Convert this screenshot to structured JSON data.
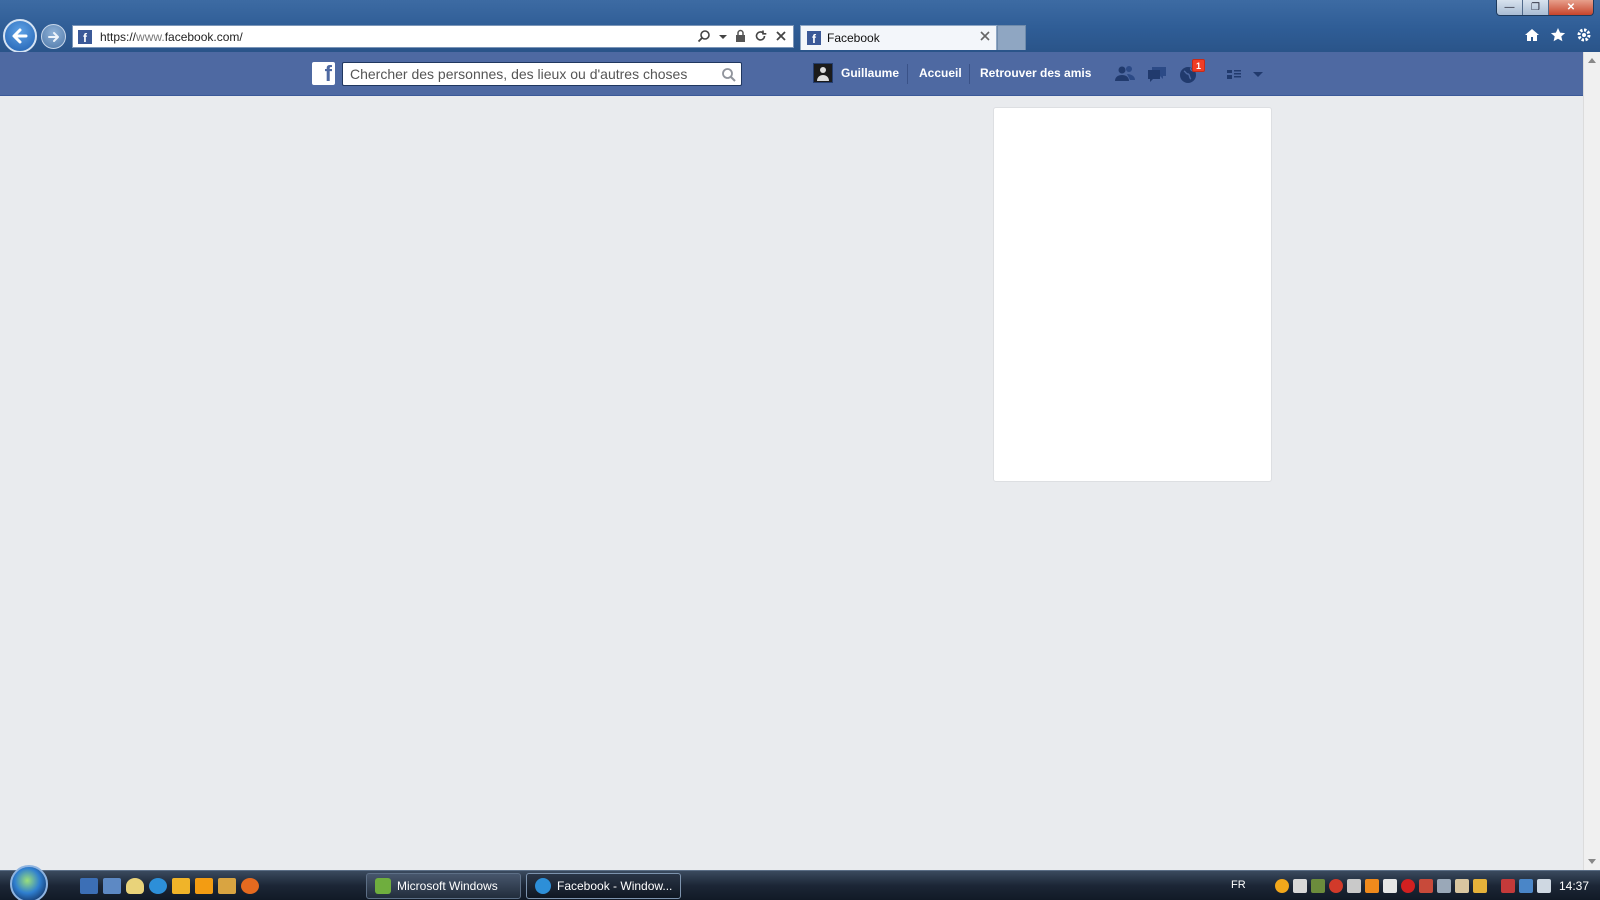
{
  "browser": {
    "url_scheme": "https://",
    "url_host_dim": "www.",
    "url_host": "facebook.com/",
    "tab_title": "Facebook",
    "controls": {
      "minimize": "—",
      "maximize": "❐",
      "close": "✕"
    }
  },
  "facebook": {
    "logo": "f",
    "search_placeholder": "Chercher des personnes, des lieux ou d'autres choses",
    "user_name": "Guillaume",
    "nav": {
      "home": "Accueil",
      "find_friends": "Retrouver des amis"
    },
    "notifications_count": "1"
  },
  "taskbar": {
    "buttons": [
      {
        "label": "Microsoft Windows"
      },
      {
        "label": "Facebook - Window..."
      }
    ],
    "language": "FR",
    "clock": "14:37"
  },
  "colors": {
    "facebook_blue": "#4e69a2",
    "page_bg": "#e9ebee",
    "badge_red": "#f03d25"
  }
}
